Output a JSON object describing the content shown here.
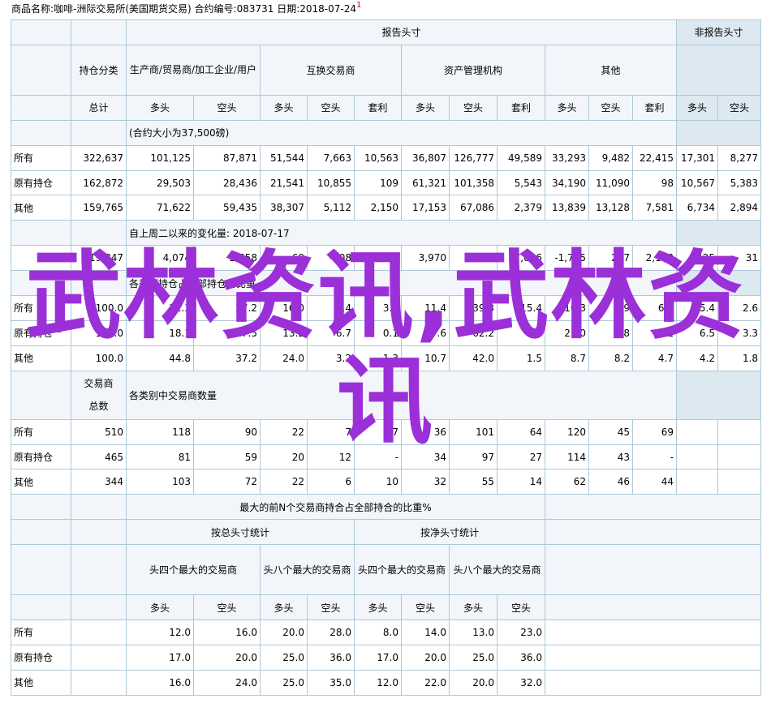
{
  "header": {
    "text": "商品名称:咖啡-洲际交易所(美国期货交易) 合约编号:083731 日期:2018-07-24",
    "mark": "1"
  },
  "top_headers": {
    "reportable": "报告头寸",
    "nonreportable": "非报告头寸",
    "holding_category": "持仓分类",
    "producer": "生产商/贸易商/加工企业/用户",
    "swap": "互换交易商",
    "managed": "资产管理机构",
    "other": "其他",
    "total": "总计",
    "long": "多头",
    "short": "空头",
    "spread": "套利"
  },
  "section1": {
    "note": "(合约大小为37,500磅)",
    "rows": [
      {
        "label": "所有",
        "values": [
          "322,637",
          "101,125",
          "87,871",
          "51,544",
          "7,663",
          "10,563",
          "36,807",
          "126,777",
          "49,589",
          "33,293",
          "9,482",
          "22,415",
          "17,301",
          "8,277"
        ]
      },
      {
        "label": "原有持仓",
        "values": [
          "162,872",
          "29,503",
          "28,436",
          "21,541",
          "10,855",
          "109",
          "61,321",
          "101,358",
          "5,543",
          "34,190",
          "11,090",
          "98",
          "10,567",
          "5,383"
        ]
      },
      {
        "label": "其他",
        "values": [
          "159,765",
          "71,622",
          "59,435",
          "38,307",
          "5,112",
          "2,150",
          "17,153",
          "67,086",
          "2,379",
          "13,839",
          "13,128",
          "7,581",
          "6,734",
          "2,894"
        ]
      }
    ]
  },
  "section2": {
    "note": "自上周二以来的变化量: 2018-07-17",
    "values": [
      "19,847",
      "4,074",
      "2,558",
      "-60",
      "-308",
      "4,097",
      "3,970",
      "4,106",
      "7,006",
      "-1,775",
      "237",
      "2,110",
      "425",
      "31"
    ]
  },
  "section3": {
    "note": "各类别持仓占全部持仓的比重",
    "star": "*2",
    "rows": [
      {
        "label": "所有",
        "values": [
          "100.0",
          "31.3",
          "27.2",
          "16.0",
          "2.4",
          "3.3",
          "11.4",
          "39.3",
          "15.4",
          "10.3",
          "2.9",
          "6.9",
          "5.4",
          "2.6"
        ]
      },
      {
        "label": "原有持仓",
        "values": [
          "100.0",
          "18.1",
          "17.5",
          "13.2",
          "6.7",
          "0.1",
          "37.6",
          "62.2",
          "3.4",
          "21.0",
          "6.8",
          "0.1",
          "6.5",
          "3.3"
        ]
      },
      {
        "label": "其他",
        "values": [
          "100.0",
          "44.8",
          "37.2",
          "24.0",
          "3.2",
          "1.3",
          "10.7",
          "42.0",
          "1.5",
          "8.7",
          "8.2",
          "4.7",
          "4.2",
          "1.8"
        ]
      }
    ]
  },
  "section4": {
    "trader_total": "交易商总数",
    "note": "各类别中交易商数量",
    "rows": [
      {
        "label": "所有",
        "values": [
          "510",
          "118",
          "90",
          "22",
          "7",
          "17",
          "36",
          "101",
          "64",
          "120",
          "45",
          "69",
          "",
          ""
        ]
      },
      {
        "label": "原有持仓",
        "values": [
          "465",
          "81",
          "59",
          "20",
          "12",
          "-",
          "34",
          "97",
          "27",
          "114",
          "43",
          "-",
          "",
          ""
        ]
      },
      {
        "label": "其他",
        "values": [
          "344",
          "103",
          "72",
          "22",
          "6",
          "10",
          "32",
          "55",
          "14",
          "62",
          "46",
          "44",
          "",
          ""
        ]
      }
    ]
  },
  "section5": {
    "title": "最大的前N个交易商持合占全部持合的比重%",
    "gross": "按总头寸统计",
    "net": "按净头寸统计",
    "top4": "头四个最大的交易商",
    "top8": "头八个最大的交易商",
    "long": "多头",
    "short": "空头",
    "rows": [
      {
        "label": "所有",
        "values": [
          "12.0",
          "16.0",
          "20.0",
          "28.0",
          "8.0",
          "14.0",
          "13.0",
          "23.0"
        ]
      },
      {
        "label": "原有持仓",
        "values": [
          "17.0",
          "20.0",
          "25.0",
          "36.0",
          "17.0",
          "20.0",
          "25.0",
          "36.0"
        ]
      },
      {
        "label": "其他",
        "values": [
          "16.0",
          "24.0",
          "25.0",
          "35.0",
          "12.0",
          "22.0",
          "20.0",
          "32.0"
        ]
      }
    ]
  },
  "watermark": "武林资讯,武林资讯"
}
